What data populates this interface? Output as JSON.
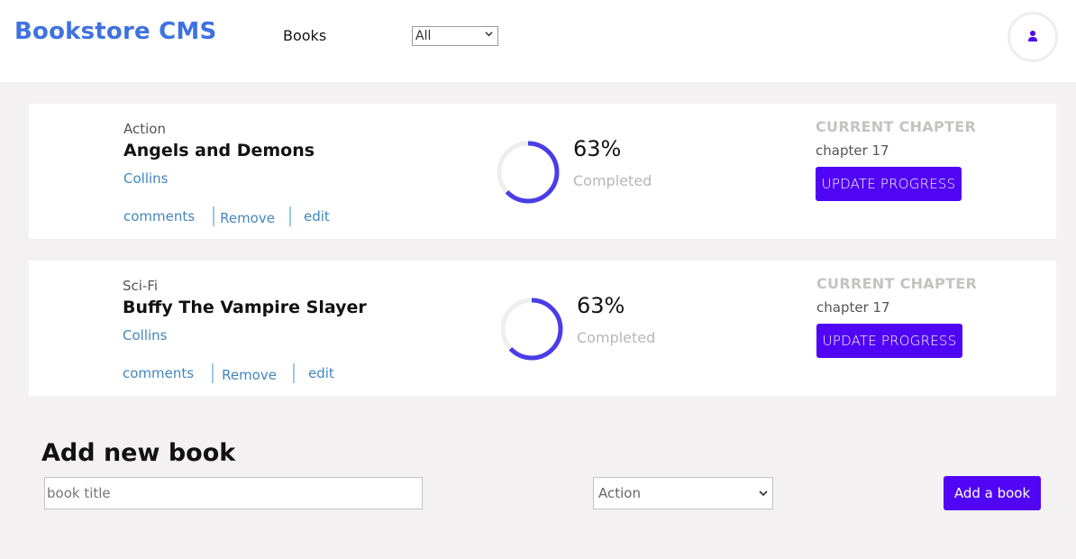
{
  "header": {
    "logo": "Bookstore CMS",
    "nav_books": "Books",
    "filter_value": "All"
  },
  "books": [
    {
      "category": "Action",
      "title": "Angels and Demons",
      "author": "Collins",
      "actions": {
        "comments": "comments",
        "remove": "Remove",
        "edit": "edit"
      },
      "progress_percent": 63,
      "percent_text": "63%",
      "completed_label": "Completed",
      "current_chapter_label": "CURRENT CHAPTER",
      "current_chapter": "chapter 17",
      "update_label": "UPDATE PROGRESS"
    },
    {
      "category": "Sci-Fi",
      "title": "Buffy The Vampire Slayer",
      "author": "Collins",
      "actions": {
        "comments": "comments",
        "remove": "Remove",
        "edit": "edit"
      },
      "progress_percent": 63,
      "percent_text": "63%",
      "completed_label": "Completed",
      "current_chapter_label": "CURRENT CHAPTER",
      "current_chapter": "chapter 17",
      "update_label": "UPDATE PROGRESS"
    }
  ],
  "add_form": {
    "heading": "Add new book",
    "title_placeholder": "book title",
    "category_value": "Action",
    "submit_label": "Add a book"
  },
  "colors": {
    "accent": "#5005f5",
    "logo": "#3f72e0",
    "link": "#4386bf",
    "ring_track": "#eeeeee",
    "ring_fill": "#4a3de6"
  },
  "icons": {
    "avatar": "user-icon",
    "select_chevron": "chevron-down-icon"
  }
}
